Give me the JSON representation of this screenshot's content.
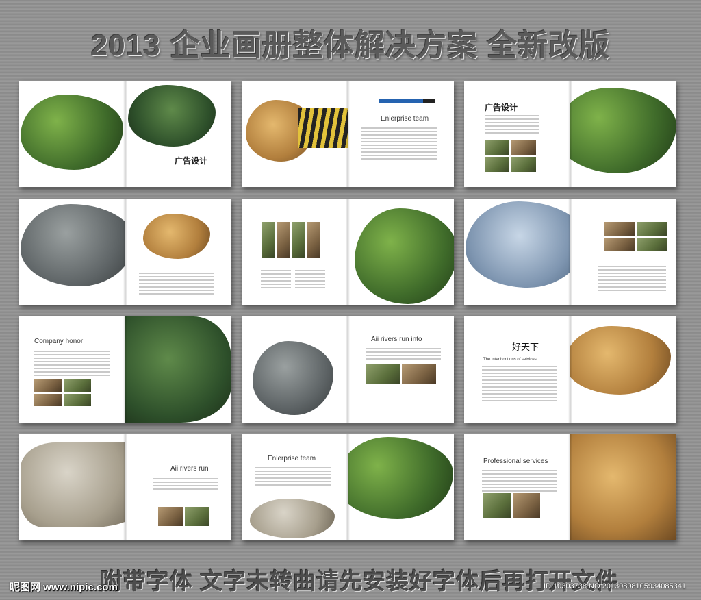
{
  "headline": "2013 企业画册整体解决方案  全新改版",
  "footer_note": "附带字体 文字未转曲请先安装好字体后再打开文件",
  "watermark": {
    "brand": "昵图网 www.nipic.com",
    "id_text": "ID:10303738 NO:20130808105934085341"
  },
  "pages": {
    "ad_design_1": "广告设计",
    "enterprise_team_1": "Enlerprise team",
    "ad_design_2": "广告设计",
    "company_honor": "Company honor",
    "rivers_into": "Aii rivers run into",
    "brand_cn": "好天下",
    "intentions": "The intenbontions of setvices",
    "rivers_run": "Aii rivers run",
    "enterprise_team_2": "Enlerprise team",
    "professional": "Professional services"
  },
  "colors": {
    "accent_bar": "#2563b0"
  }
}
